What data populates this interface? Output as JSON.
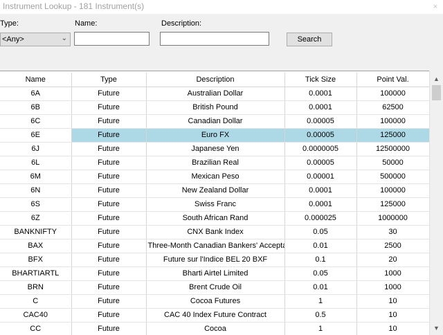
{
  "window": {
    "title": "Instrument Lookup - 181 Instrument(s)",
    "close_glyph": "×"
  },
  "filters": {
    "type_label": "Type:",
    "type_value": "<Any>",
    "name_label": "Name:",
    "name_value": "",
    "description_label": "Description:",
    "description_value": "",
    "search_label": "Search"
  },
  "table": {
    "columns": [
      "Name",
      "Type",
      "Description",
      "Tick Size",
      "Point Val."
    ],
    "selected_row": 3,
    "rows": [
      [
        "6A",
        "Future",
        "Australian Dollar",
        "0.0001",
        "100000"
      ],
      [
        "6B",
        "Future",
        "British Pound",
        "0.0001",
        "62500"
      ],
      [
        "6C",
        "Future",
        "Canadian Dollar",
        "0.00005",
        "100000"
      ],
      [
        "6E",
        "Future",
        "Euro FX",
        "0.00005",
        "125000"
      ],
      [
        "6J",
        "Future",
        "Japanese Yen",
        "0.0000005",
        "12500000"
      ],
      [
        "6L",
        "Future",
        "Brazilian Real",
        "0.00005",
        "50000"
      ],
      [
        "6M",
        "Future",
        "Mexican Peso",
        "0.00001",
        "500000"
      ],
      [
        "6N",
        "Future",
        "New Zealand Dollar",
        "0.0001",
        "100000"
      ],
      [
        "6S",
        "Future",
        "Swiss Franc",
        "0.0001",
        "125000"
      ],
      [
        "6Z",
        "Future",
        "South African Rand",
        "0.000025",
        "1000000"
      ],
      [
        "BANKNIFTY",
        "Future",
        "CNX Bank Index",
        "0.05",
        "30"
      ],
      [
        "BAX",
        "Future",
        "Three-Month Canadian Bankers' Accepta",
        "0.01",
        "2500"
      ],
      [
        "BFX",
        "Future",
        "Future sur l'Indice BEL 20 BXF",
        "0.1",
        "20"
      ],
      [
        "BHARTIARTL",
        "Future",
        "Bharti Airtel Limited",
        "0.05",
        "1000"
      ],
      [
        "BRN",
        "Future",
        "Brent Crude Oil",
        "0.01",
        "1000"
      ],
      [
        "C",
        "Future",
        "Cocoa Futures",
        "1",
        "10"
      ],
      [
        "CAC40",
        "Future",
        "CAC 40 Index Future Contract",
        "0.5",
        "10"
      ],
      [
        "CC",
        "Future",
        "Cocoa",
        "1",
        "10"
      ]
    ]
  },
  "scrollbar": {
    "up_glyph": "▲",
    "down_glyph": "▼"
  }
}
